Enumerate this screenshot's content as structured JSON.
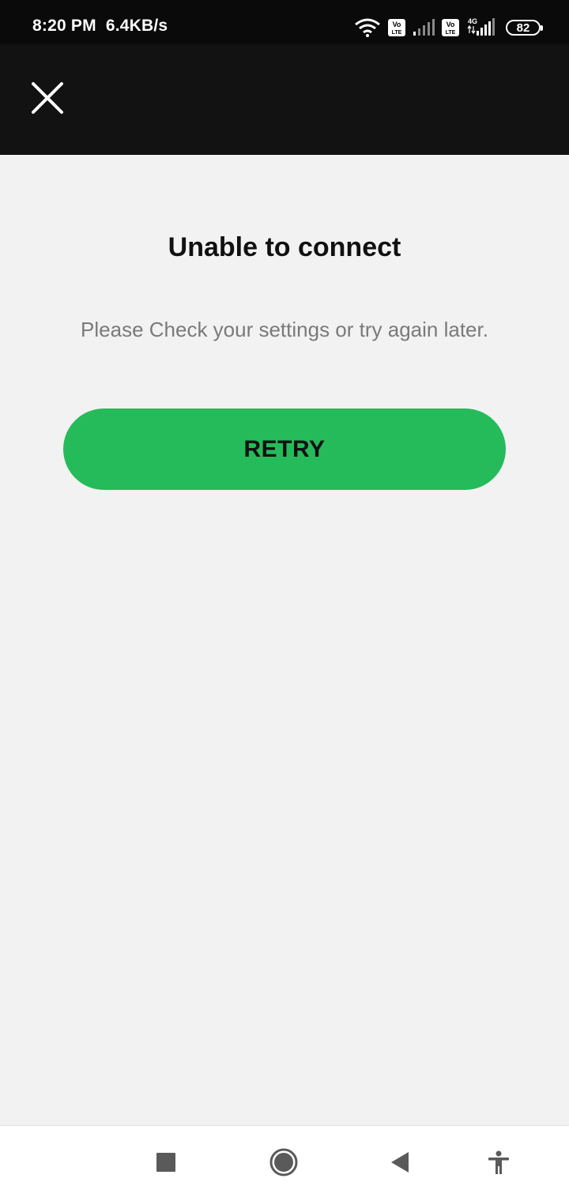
{
  "status_bar": {
    "time": "8:20 PM",
    "speed": "6.4KB/s",
    "battery": "82",
    "network_type": "4G",
    "volte_label_top": "Vo",
    "volte_label_bottom": "LTE",
    "icons": [
      "wifi-icon",
      "volte-icon",
      "signal-icon",
      "volte-icon",
      "4g-signal-icon",
      "battery-icon"
    ]
  },
  "app_bar": {
    "close_icon": "close-icon"
  },
  "error": {
    "title": "Unable to connect",
    "message": "Please Check your settings or try again later.",
    "retry_label": "RETRY"
  },
  "nav_bar": {
    "icons": [
      "recents-square-icon",
      "home-circle-icon",
      "back-triangle-icon",
      "accessibility-icon"
    ]
  },
  "colors": {
    "accent": "#25bb5a",
    "background": "#f2f2f2",
    "app_bar": "#121212",
    "status_bar": "#0a0a0a"
  }
}
